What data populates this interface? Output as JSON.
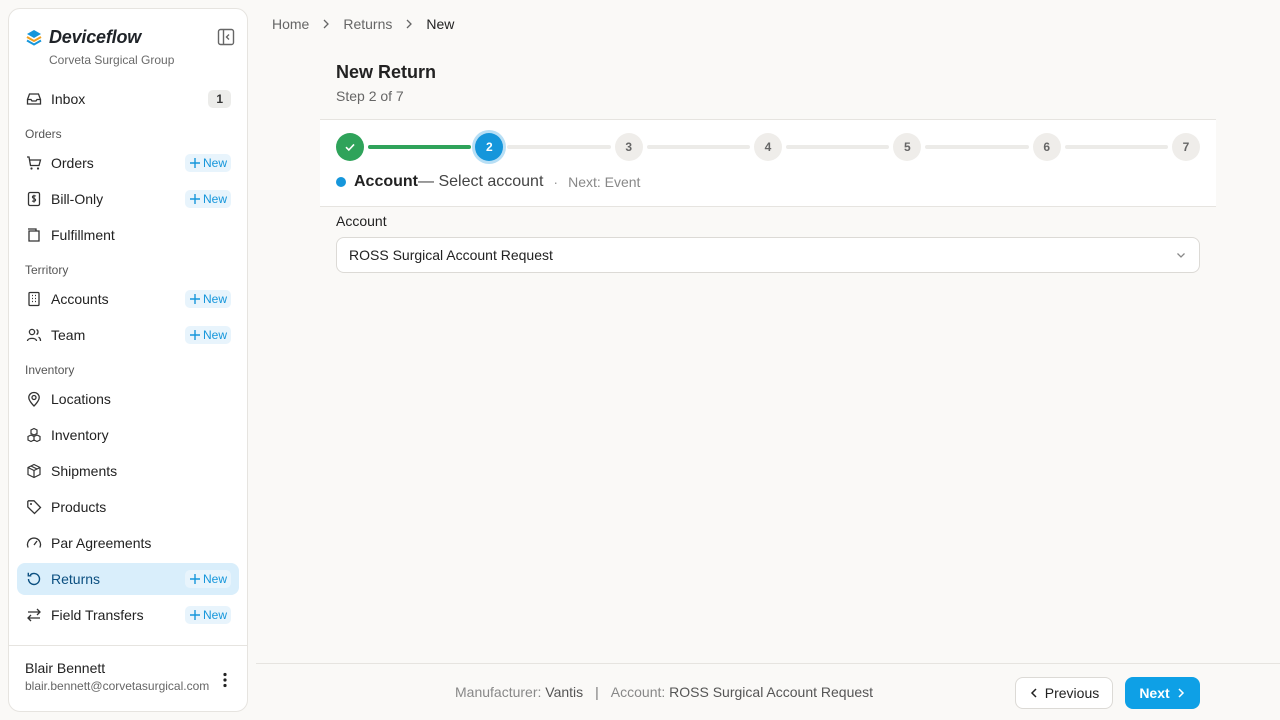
{
  "brand": {
    "name": "Deviceflow",
    "org": "Corveta Surgical Group"
  },
  "sidebar": {
    "inbox": {
      "label": "Inbox",
      "count": "1"
    },
    "sections": {
      "orders": "Orders",
      "territory": "Territory",
      "inventory": "Inventory"
    },
    "new_label": "New",
    "items": {
      "orders": "Orders",
      "bill_only": "Bill-Only",
      "fulfillment": "Fulfillment",
      "accounts": "Accounts",
      "team": "Team",
      "locations": "Locations",
      "inventory": "Inventory",
      "shipments": "Shipments",
      "products": "Products",
      "par_agreements": "Par Agreements",
      "returns": "Returns",
      "field_transfers": "Field Transfers"
    }
  },
  "user": {
    "name": "Blair Bennett",
    "email": "blair.bennett@corvetasurgical.com"
  },
  "breadcrumb": {
    "home": "Home",
    "returns": "Returns",
    "current": "New"
  },
  "page": {
    "title": "New Return",
    "subtitle": "Step 2 of 7"
  },
  "stepper": {
    "steps": [
      "1",
      "2",
      "3",
      "4",
      "5",
      "6",
      "7"
    ],
    "completed": 1,
    "current_index": 1,
    "caption_title": "Account",
    "caption_desc": "— Select account",
    "caption_sep": "·",
    "caption_next": "Next: Event"
  },
  "form": {
    "account_label": "Account",
    "account_value": "ROSS Surgical Account Request"
  },
  "footer": {
    "manufacturer_label": "Manufacturer:",
    "manufacturer_value": "Vantis",
    "separator": "|",
    "account_label": "Account:",
    "account_value": "ROSS Surgical Account Request",
    "previous": "Previous",
    "next": "Next"
  },
  "colors": {
    "accent": "#0ea0e6",
    "success": "#2fa35a",
    "active_bg": "#d9eefb"
  }
}
